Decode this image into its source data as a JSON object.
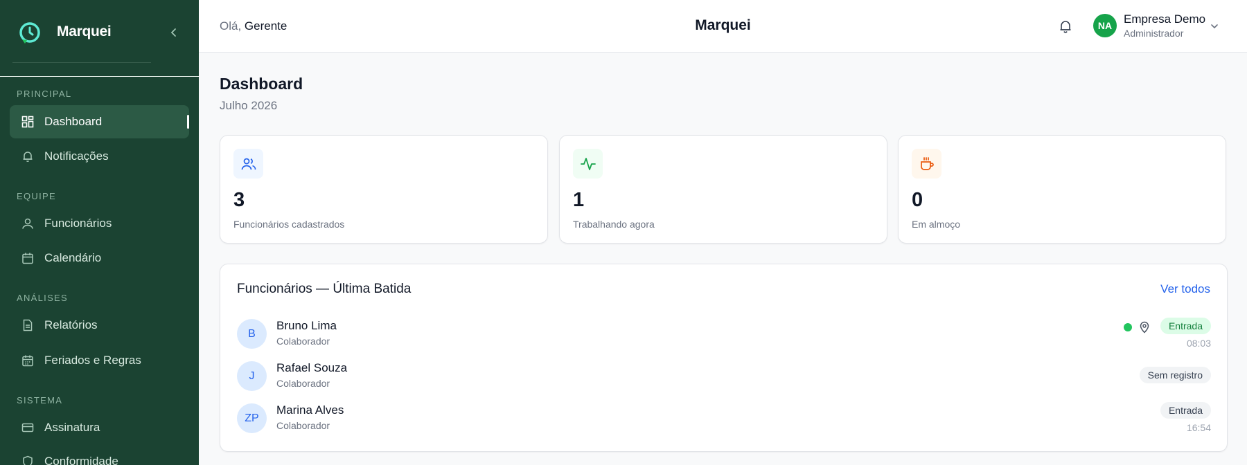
{
  "app": {
    "name": "Marquei"
  },
  "sidebar": {
    "sections": [
      {
        "title": "PRINCIPAL"
      },
      {
        "title": "EQUIPE"
      },
      {
        "title": "ANÁLISES"
      },
      {
        "title": "SISTEMA"
      }
    ],
    "items": [
      {
        "label": "Dashboard",
        "icon": "grid-icon",
        "active": true
      },
      {
        "label": "Notificações",
        "icon": "bell-icon"
      },
      {
        "label": "Funcionários",
        "icon": "user-icon"
      },
      {
        "label": "Calendário",
        "icon": "calendar-icon"
      },
      {
        "label": "Relatórios",
        "icon": "document-icon"
      },
      {
        "label": "Feriados e Regras",
        "icon": "calendar-icon"
      },
      {
        "label": "Assinatura",
        "icon": "credit-card-icon"
      },
      {
        "label": "Conformidade",
        "icon": "shield-icon"
      }
    ]
  },
  "header": {
    "greeting_prefix": "Olá,",
    "greeting_name": "Gerente",
    "title": "Marquei",
    "user_initials": "NA",
    "company_name": "Empresa Demo",
    "company_role": "Administrador"
  },
  "main": {
    "title": "Dashboard",
    "subtitle": "Julho 2026",
    "stats": [
      {
        "value": "3",
        "label": "Funcionários cadastrados",
        "icon": "users-icon",
        "color": "#2563eb",
        "bg": "#eff6ff"
      },
      {
        "value": "1",
        "label": "Trabalhando agora",
        "icon": "activity-icon",
        "color": "#16a34a",
        "bg": "#f0fdf4"
      },
      {
        "value": "0",
        "label": "Em almoço",
        "icon": "coffee-icon",
        "color": "#ea580c",
        "bg": "#fff7ed"
      }
    ],
    "list": {
      "title": "Funcionários — Última Batida",
      "view_all": "Ver todos",
      "rows": [
        {
          "initials": "B",
          "name": "Bruno Lima",
          "role": "Colaborador",
          "status": "Entrada",
          "time": "08:03",
          "online": true
        },
        {
          "initials": "J",
          "name": "Rafael Souza",
          "role": "Colaborador",
          "status": "Sem registro",
          "time": ""
        },
        {
          "initials": "ZP",
          "name": "Marina Alves",
          "role": "Colaborador",
          "status": "Entrada",
          "time": "16:54"
        }
      ]
    }
  },
  "colors": {
    "sidebar_bg": "#1b4332",
    "accent": "#16a34a",
    "link": "#2563eb"
  }
}
